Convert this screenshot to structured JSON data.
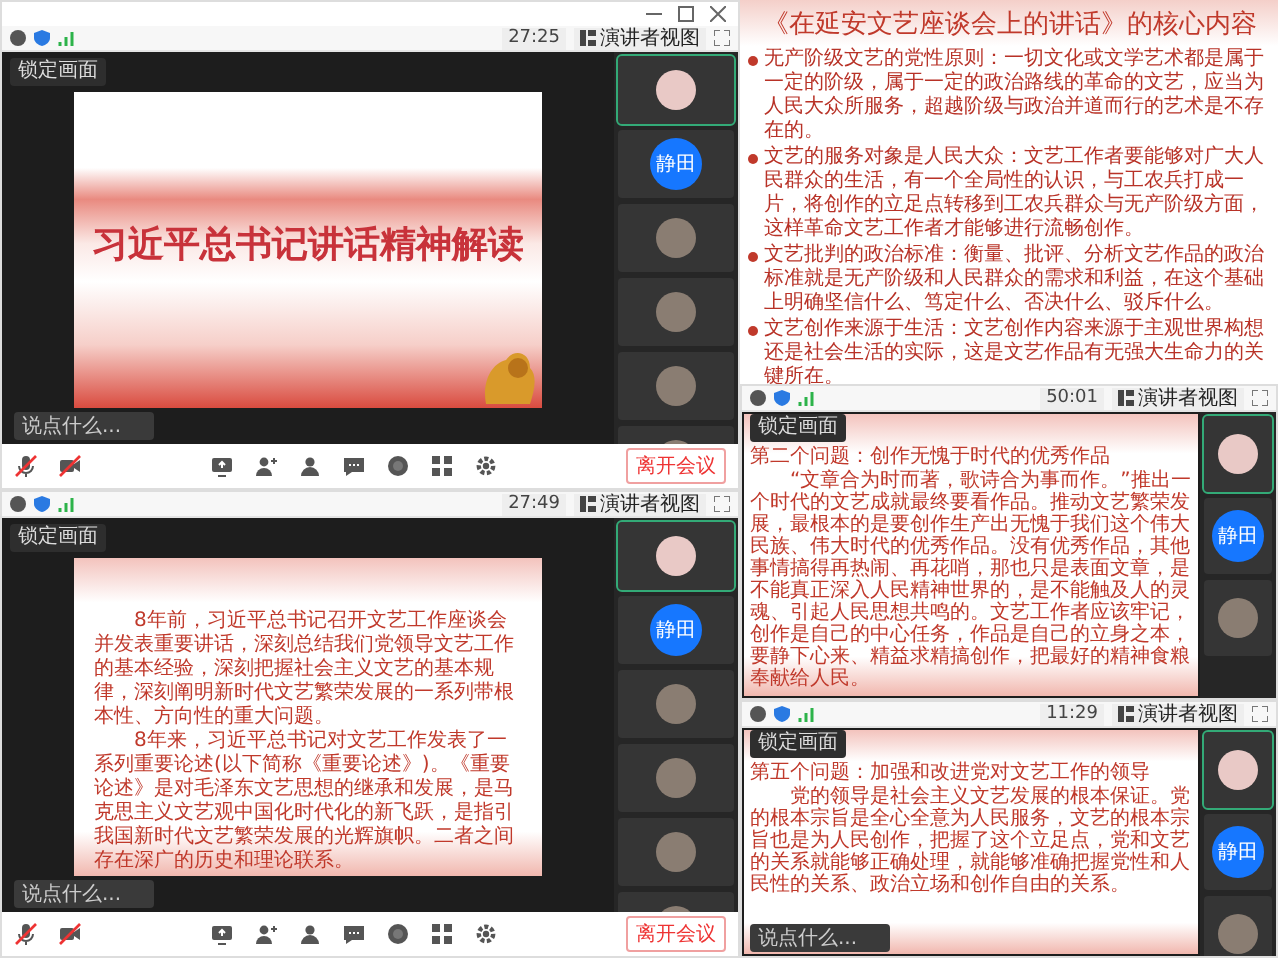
{
  "windows": [
    {
      "title_bar": true,
      "time": "27:25",
      "view": "演讲者视图",
      "lock": "锁定画面",
      "slide": {
        "kind": "title",
        "title": "习近平总书记讲话精神解读"
      },
      "chat_placeholder": "说点什么...",
      "participants": [
        {
          "kind": "photo"
        },
        {
          "kind": "initials",
          "text": "静田"
        },
        {
          "kind": "photo"
        },
        {
          "kind": "photo"
        },
        {
          "kind": "photo"
        },
        {
          "kind": "photo"
        }
      ],
      "leave": "离开会议"
    },
    {
      "time": "27:49",
      "view": "演讲者视图",
      "lock": "锁定画面",
      "slide": {
        "kind": "paragraphs",
        "paragraphs": [
          "8年前，习近平总书记召开文艺工作座谈会并发表重要讲话，深刻总结我们党领导文艺工作的基本经验，深刻把握社会主义文艺的基本规律，深刻阐明新时代文艺繁荣发展的一系列带根本性、方向性的重大问题。",
          "8年来，习近平总书记对文艺工作发表了一系列重要论述(以下简称《重要论述》)。《重要论述》是对毛泽东文艺思想的继承和发展，是马克思主义文艺观中国化时代化的新飞跃，是指引我国新时代文艺繁荣发展的光辉旗帜。二者之间存在深广的历史和理论联系。"
        ]
      },
      "chat_placeholder": "说点什么...",
      "participants": [
        {
          "kind": "photo"
        },
        {
          "kind": "initials",
          "text": "静田"
        },
        {
          "kind": "photo"
        },
        {
          "kind": "photo"
        },
        {
          "kind": "photo"
        },
        {
          "kind": "photo"
        }
      ],
      "leave": "离开会议"
    },
    {
      "time": "50:01",
      "view": "演讲者视图",
      "lock": "锁定画面",
      "slide": {
        "kind": "section",
        "heading": "第二个问题：创作无愧于时代的优秀作品",
        "paragraphs": [
          "“文章合为时而著，歌诗合为事而作。”推出一个时代的文艺成就最终要看作品。推动文艺繁荣发展，最根本的是要创作生产出无愧于我们这个伟大民族、伟大时代的优秀作品。没有优秀作品，其他事情搞得再热闹、再花哨，那也只是表面文章，是不能真正深入人民精神世界的，是不能触及人的灵魂、引起人民思想共鸣的。文艺工作者应该牢记，创作是自己的中心任务，作品是自己的立身之本，要静下心来、精益求精搞创作，把最好的精神食粮奉献给人民。"
        ]
      },
      "participants": [
        {
          "kind": "photo"
        },
        {
          "kind": "initials",
          "text": "静田"
        },
        {
          "kind": "photo"
        }
      ]
    },
    {
      "time": "11:29",
      "view": "演讲者视图",
      "lock": "锁定画面",
      "slide": {
        "kind": "section",
        "heading": "第五个问题：加强和改进党对文艺工作的领导",
        "paragraphs": [
          "党的领导是社会主义文艺发展的根本保证。党的根本宗旨是全心全意为人民服务，文艺的根本宗旨也是为人民创作，把握了这个立足点，党和文艺的关系就能够正确处理，就能够准确把握党性和人民性的关系、政治立场和创作自由的关系。"
        ]
      },
      "chat_placeholder": "说点什么...",
      "participants": [
        {
          "kind": "photo"
        },
        {
          "kind": "initials",
          "text": "静田"
        },
        {
          "kind": "photo"
        }
      ]
    }
  ],
  "slide": {
    "title": "《在延安文艺座谈会上的讲话》的核心内容",
    "bullets": [
      "无产阶级文艺的党性原则：一切文化或文学艺术都是属于一定的阶级，属于一定的政治路线的革命的文艺，应当为人民大众所服务，超越阶级与政治并道而行的艺术是不存在的。",
      "文艺的服务对象是人民大众：文艺工作者要能够对广大人民群众的生活，有一个全局性的认识，与工农兵打成一片，将创作的立足点转移到工农兵群众与无产阶级方面，这样革命文艺工作者才能够进行流畅创作。",
      "文艺批判的政治标准：衡量、批评、分析文艺作品的政治标准就是无产阶级和人民群众的需求和利益，在这个基础上明确坚信什么、笃定什么、否决什么、驳斥什么。",
      "文艺创作来源于生活：文艺创作内容来源于主观世界构想还是社会生活的实际，这是文艺作品有无强大生命力的关键所在。"
    ]
  }
}
